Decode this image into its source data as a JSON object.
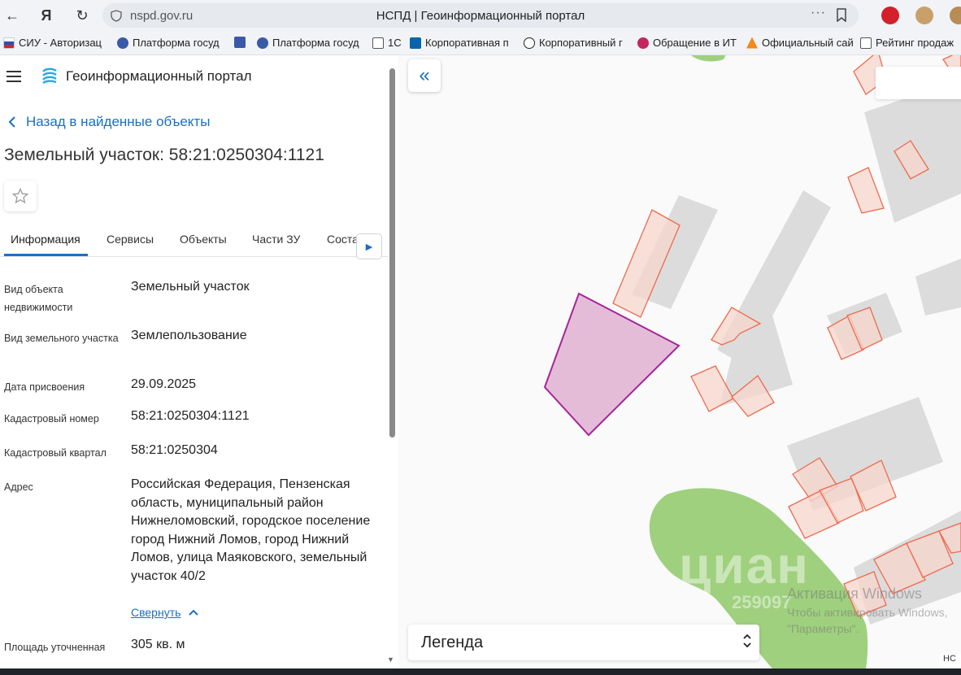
{
  "browser": {
    "url": "nspd.gov.ru",
    "page_title": "НСПД | Геоинформационный портал",
    "yandex_glyph": "Я",
    "bookmarks": [
      {
        "label": "СИУ - Авторизац",
        "icon_color": "#d6261d"
      },
      {
        "label": "Платформа госуд",
        "icon_color": "#3a59a8"
      },
      {
        "label": "Платформа госуд",
        "icon_color": "#3a59a8"
      },
      {
        "label": "1С",
        "icon_color": "#ffffff"
      },
      {
        "label": "Корпоративная п",
        "icon_color": "#0a64ad"
      },
      {
        "label": "Корпоративный г",
        "icon_color": "#222222"
      },
      {
        "label": "Обращение в ИТ",
        "icon_color": "#c3265b"
      },
      {
        "label": "Официальный сай",
        "icon_color": "#f28a1c"
      },
      {
        "label": "Рейтинг продаж",
        "icon_color": "#ffffff"
      }
    ]
  },
  "header": {
    "title": "Геоинформационный портал"
  },
  "nav": {
    "back_label": "Назад в найденные объекты"
  },
  "object": {
    "title": "Земельный участок: 58:21:0250304:1121"
  },
  "tabs": [
    "Информация",
    "Сервисы",
    "Объекты",
    "Части ЗУ",
    "Соста"
  ],
  "attributes": [
    {
      "label": "Вид объекта недвижимости",
      "value": "Земельный участок"
    },
    {
      "label": "Вид земельного участка",
      "value": "Землепользование"
    },
    {
      "label": "Дата присвоения",
      "value": "29.09.2025"
    },
    {
      "label": "Кадастровый номер",
      "value": "58:21:0250304:1121"
    },
    {
      "label": "Кадастровый квартал",
      "value": "58:21:0250304"
    },
    {
      "label": "Адрес",
      "value": "Российская Федерация, Пензенская область, муниципальный район Нижнеломовский, городское поселение город Нижний Ломов, город Нижний Ломов, улица Маяковского, земельный участок 40/2"
    },
    {
      "label": "Площадь уточненная",
      "value": "305 кв. м"
    }
  ],
  "collapse_label": "Свернуть",
  "map": {
    "legend_title": "Легенда",
    "watermark": "циан",
    "watermark_number": "259097",
    "activation_title": "Активация Windows",
    "activation_text": "Чтобы активировать Windows,",
    "activation_text2": "\"Параметры\".",
    "copyright_stub": "НС",
    "colors": {
      "building": "#dcdcdc",
      "parcel_stroke": "#ee6a4d",
      "parcel_fill": "#f7d7cd",
      "selected_fill": "#e5bcd8",
      "selected_stroke": "#a3269a",
      "greenery": "#9fd07e"
    }
  }
}
